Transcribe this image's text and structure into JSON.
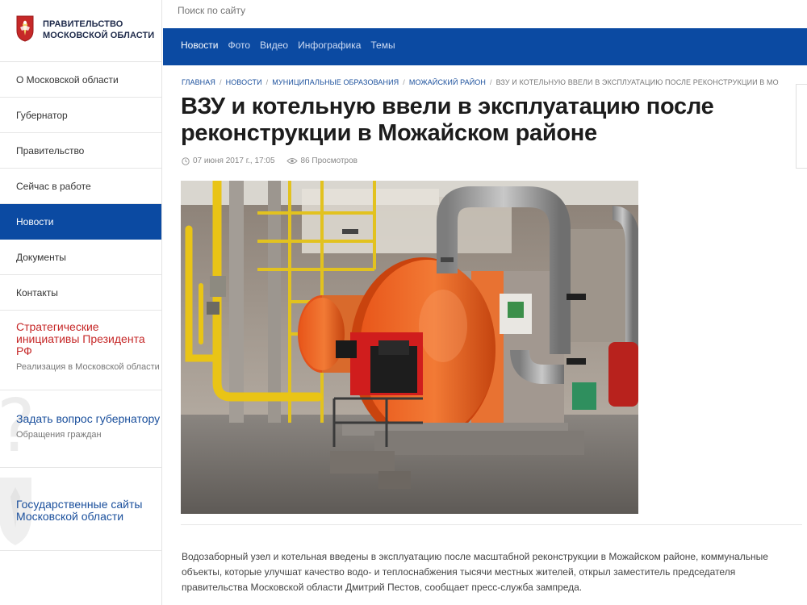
{
  "brand": {
    "line1": "ПРАВИТЕЛЬСТВО",
    "line2": "МОСКОВСКОЙ ОБЛАСТИ"
  },
  "search": {
    "placeholder": "Поиск по сайту"
  },
  "sidebar": {
    "items": [
      {
        "label": "О Московской области",
        "active": false
      },
      {
        "label": "Губернатор",
        "active": false
      },
      {
        "label": "Правительство",
        "active": false
      },
      {
        "label": "Сейчас в работе",
        "active": false
      },
      {
        "label": "Новости",
        "active": true
      },
      {
        "label": "Документы",
        "active": false
      },
      {
        "label": "Контакты",
        "active": false
      }
    ],
    "promos": [
      {
        "title": "Стратегические инициативы Президента РФ",
        "subtitle": "Реализация в Московской области"
      },
      {
        "title": "Задать вопрос губернатору",
        "subtitle": "Обращения граждан"
      },
      {
        "title": "Государственные сайты Московской области",
        "subtitle": ""
      }
    ]
  },
  "topnav": {
    "items": [
      "Новости",
      "Фото",
      "Видео",
      "Инфографика",
      "Темы"
    ]
  },
  "breadcrumb": {
    "items": [
      "Главная",
      "Новости",
      "Муниципальные образования",
      "Можайский район"
    ],
    "current": "ВЗУ и котельную ввели в эксплуатацию после реконструкции в Можайском районе"
  },
  "article": {
    "title": "ВЗУ и котельную ввели в эксплуатацию после реконструкции в Можайском районе",
    "date": "07 июня 2017 г., 17:05",
    "views": "86 Просмотров",
    "image_alt": "Котельная: оранжевые котлы с горелками, желтые газовые трубы",
    "body": "Водозаборный узел и котельная введены в эксплуатацию после масштабной реконструкции в Можайском районе, коммунальные объекты, которые улучшат качество водо- и теплоснабжения тысячи местных жителей, открыл заместитель председателя правительства Московской области Дмитрий Пестов, сообщает пресс-служба зампреда."
  },
  "colors": {
    "primary": "#0b4aa2",
    "link": "#1a4f9c",
    "accent_red": "#c62828"
  }
}
